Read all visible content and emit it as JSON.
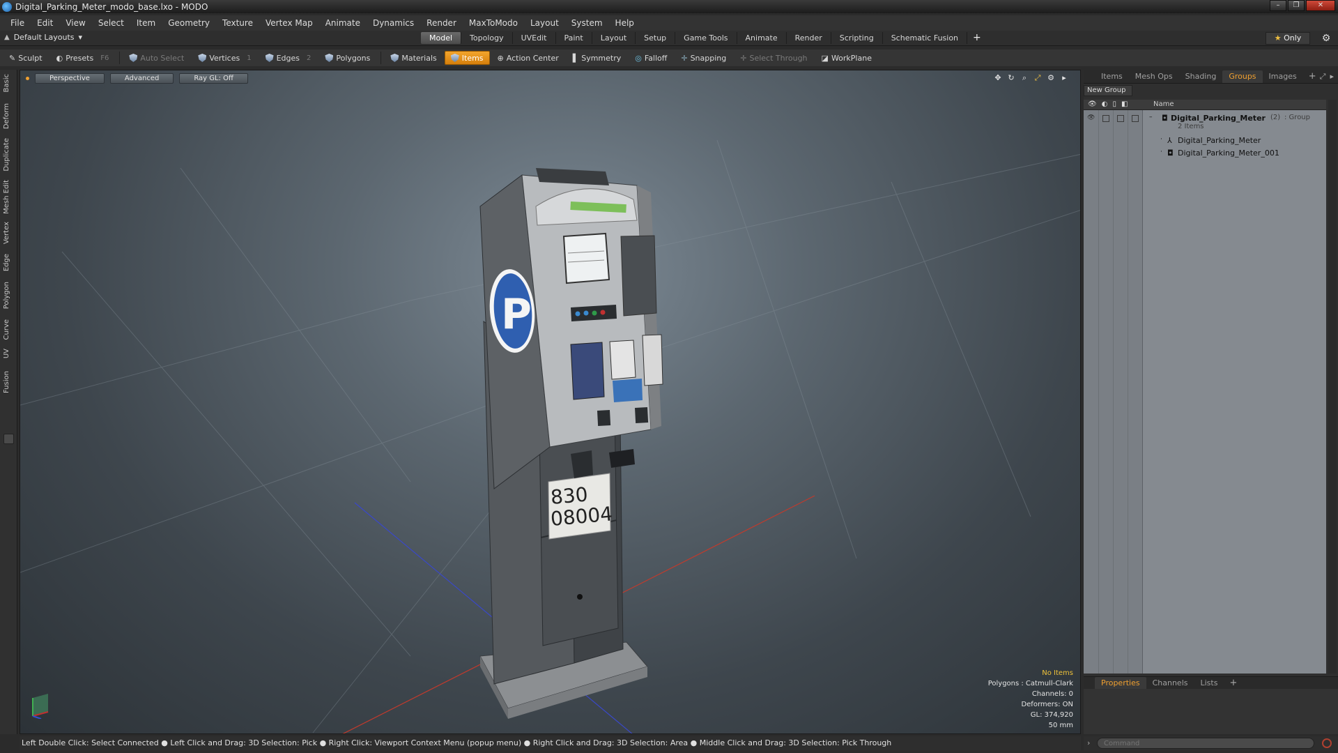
{
  "window": {
    "title": "Digital_Parking_Meter_modo_base.lxo - MODO"
  },
  "menu": [
    "File",
    "Edit",
    "View",
    "Select",
    "Item",
    "Geometry",
    "Texture",
    "Vertex Map",
    "Animate",
    "Dynamics",
    "Render",
    "MaxToModo",
    "Layout",
    "System",
    "Help"
  ],
  "layout": {
    "selector": "Default Layouts",
    "tabs": [
      "Model",
      "Topology",
      "UVEdit",
      "Paint",
      "Layout",
      "Setup",
      "Game Tools",
      "Animate",
      "Render",
      "Scripting",
      "Schematic Fusion"
    ],
    "active_tab": "Model",
    "only_label": "Only"
  },
  "toolbar": {
    "sculpt": "Sculpt",
    "presets": "Presets",
    "presets_hint": "F6",
    "auto_select": "Auto Select",
    "vertices": "Vertices",
    "vertices_hint": "1",
    "edges": "Edges",
    "edges_hint": "2",
    "polygons": "Polygons",
    "materials": "Materials",
    "items": "Items",
    "action_center": "Action Center",
    "symmetry": "Symmetry",
    "falloff": "Falloff",
    "snapping": "Snapping",
    "select_through": "Select Through",
    "workplane": "WorkPlane"
  },
  "side_tabs": [
    "Basic",
    "Deform",
    "Duplicate",
    "Mesh Edit",
    "Vertex",
    "Edge",
    "Polygon",
    "Curve",
    "UV",
    "Fusion"
  ],
  "viewport": {
    "view_mode": "Perspective",
    "shading": "Advanced",
    "raygl": "Ray GL: Off",
    "info": {
      "selection": "No Items",
      "polygons": "Polygons : Catmull-Clark",
      "channels": "Channels: 0",
      "deformers": "Deformers: ON",
      "gl": "GL: 374,920",
      "scale": "50 mm"
    },
    "meter_label_line1": "830",
    "meter_label_line2": "08004"
  },
  "status": "Left Double Click: Select Connected ● Left Click and Drag: 3D Selection: Pick ● Right Click: Viewport Context Menu (popup menu) ● Right Click and Drag: 3D Selection: Area ● Middle Click and Drag: 3D Selection: Pick Through",
  "right_panel": {
    "tabs": [
      "Items",
      "Mesh Ops",
      "Shading",
      "Groups",
      "Images"
    ],
    "active_tab": "Groups",
    "new_group": "New Group",
    "name_header": "Name",
    "group": {
      "name": "Digital_Parking_Meter",
      "count": "(2)",
      "type": ": Group",
      "items_label": "2 Items",
      "children": [
        "Digital_Parking_Meter",
        "Digital_Parking_Meter_001"
      ]
    },
    "bottom_tabs": [
      "Properties",
      "Channels",
      "Lists"
    ],
    "bottom_active": "Properties",
    "command_placeholder": "Command"
  },
  "colors": {
    "accent": "#f0a030",
    "active_button": "#e89420",
    "viewport_bg": "#5c6770"
  }
}
